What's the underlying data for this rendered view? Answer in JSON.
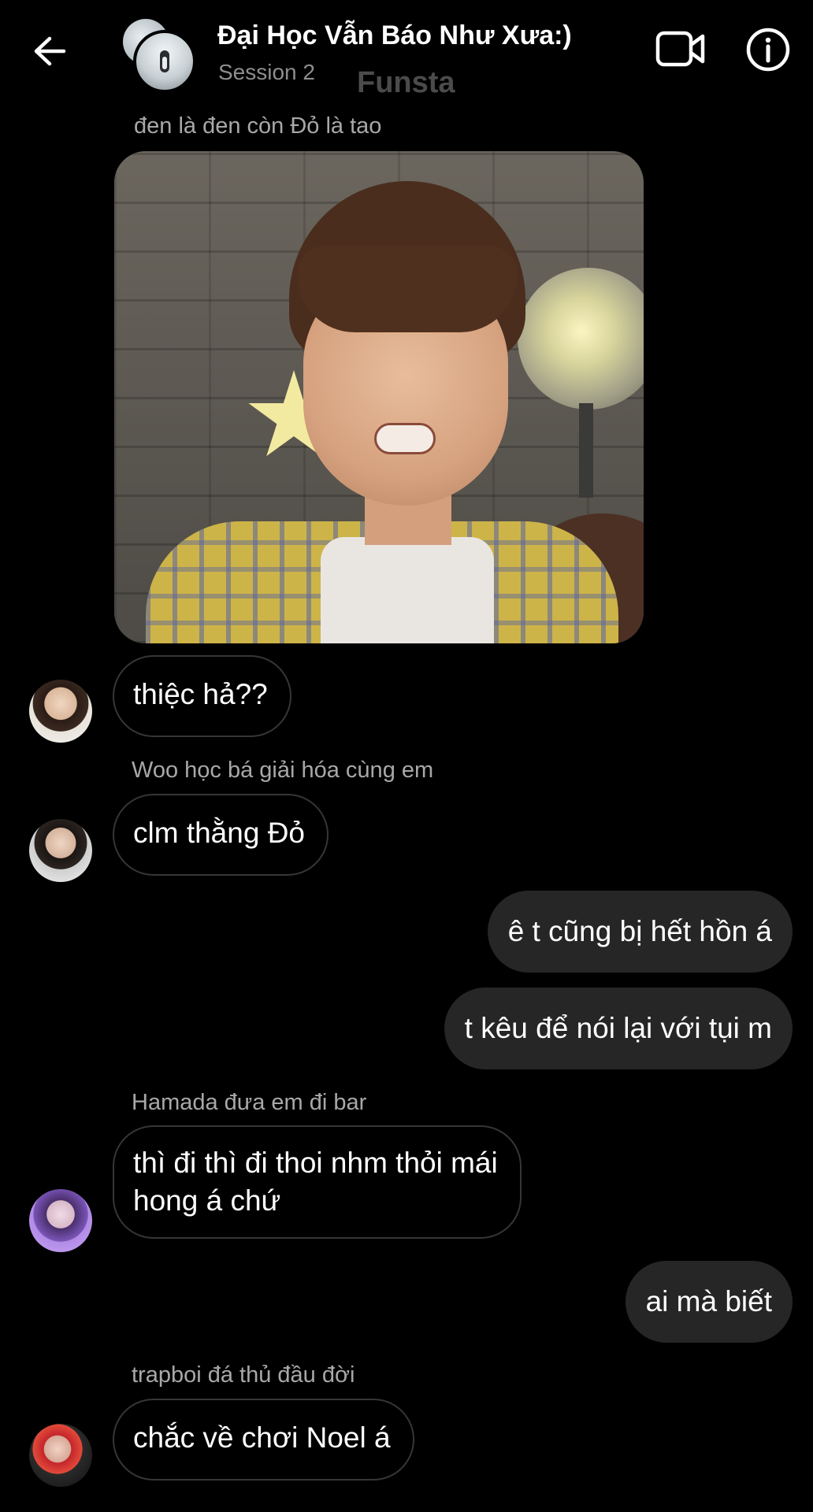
{
  "header": {
    "title": "Đại Học Vẫn Báo Như Xưa:)",
    "subtitle": "Session 2",
    "watermark": "Funsta",
    "back_icon": "arrow-left-icon",
    "video_icon": "video-camera-icon",
    "info_icon": "info-icon"
  },
  "colors": {
    "background": "#000000",
    "incoming_border": "#363636",
    "outgoing_bubble": "#262626",
    "sender_name": "#a8a8a8"
  },
  "messages": [
    {
      "type": "sender",
      "text": "đen là đen còn Đỏ là tao"
    },
    {
      "type": "image",
      "alt": "photo"
    },
    {
      "type": "incoming",
      "text": "thiệc hả??"
    },
    {
      "type": "sender",
      "text": "Woo học bá giải hóa cùng em"
    },
    {
      "type": "incoming",
      "text": "clm thằng Đỏ"
    },
    {
      "type": "outgoing",
      "text": "ê t cũng bị hết hồn á"
    },
    {
      "type": "outgoing",
      "text": "t kêu để nói lại với tụi m"
    },
    {
      "type": "sender",
      "text": "Hamada đưa em đi bar"
    },
    {
      "type": "incoming",
      "lines": [
        "thì đi thì đi thoi nhm thỏi mái",
        "hong á chứ"
      ]
    },
    {
      "type": "outgoing",
      "text": "ai mà biết"
    },
    {
      "type": "sender",
      "text": "trapboi đá thủ đầu đời"
    },
    {
      "type": "incoming",
      "text": "chắc về chơi Noel á"
    }
  ]
}
